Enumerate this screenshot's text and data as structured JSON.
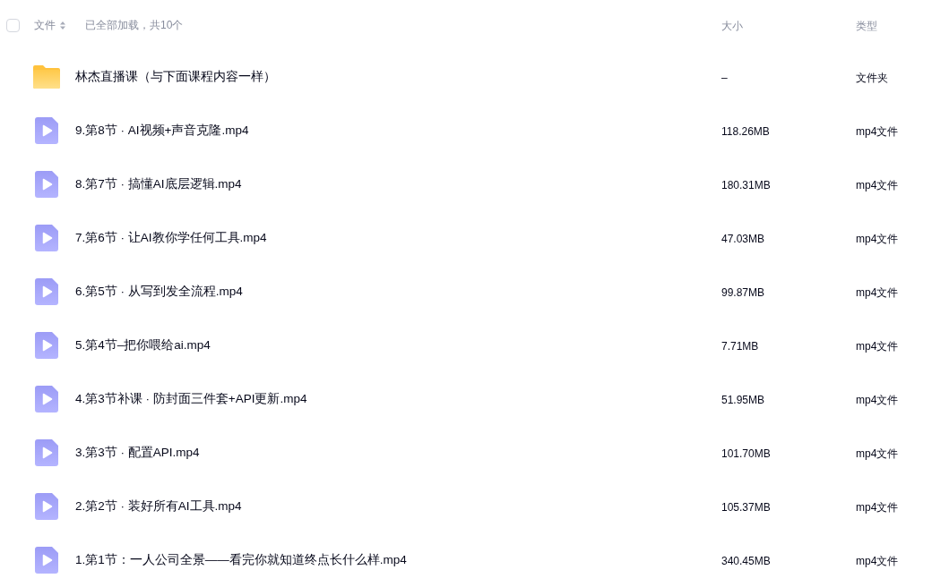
{
  "header": {
    "select_all_checked": false,
    "name_label": "文件",
    "status": "已全部加载，共10个",
    "size_label": "大小",
    "type_label": "类型"
  },
  "files": [
    {
      "kind": "folder",
      "name": "林杰直播课（与下面课程内容一样）",
      "size": "–",
      "type": "文件夹"
    },
    {
      "kind": "video",
      "name": "9.第8节 · AI视频+声音克隆.mp4",
      "size": "118.26MB",
      "type": "mp4文件"
    },
    {
      "kind": "video",
      "name": "8.第7节 · 搞懂AI底层逻辑.mp4",
      "size": "180.31MB",
      "type": "mp4文件"
    },
    {
      "kind": "video",
      "name": "7.第6节 · 让AI教你学任何工具.mp4",
      "size": "47.03MB",
      "type": "mp4文件"
    },
    {
      "kind": "video",
      "name": "6.第5节 · 从写到发全流程.mp4",
      "size": "99.87MB",
      "type": "mp4文件"
    },
    {
      "kind": "video",
      "name": "5.第4节–把你喂给ai.mp4",
      "size": "7.71MB",
      "type": "mp4文件"
    },
    {
      "kind": "video",
      "name": "4.第3节补课 · 防封面三件套+API更新.mp4",
      "size": "51.95MB",
      "type": "mp4文件"
    },
    {
      "kind": "video",
      "name": "3.第3节 · 配置API.mp4",
      "size": "101.70MB",
      "type": "mp4文件"
    },
    {
      "kind": "video",
      "name": "2.第2节 · 装好所有AI工具.mp4",
      "size": "105.37MB",
      "type": "mp4文件"
    },
    {
      "kind": "video",
      "name": "1.第1节：一人公司全景——看完你就知道终点长什么样.mp4",
      "size": "340.45MB",
      "type": "mp4文件"
    }
  ]
}
